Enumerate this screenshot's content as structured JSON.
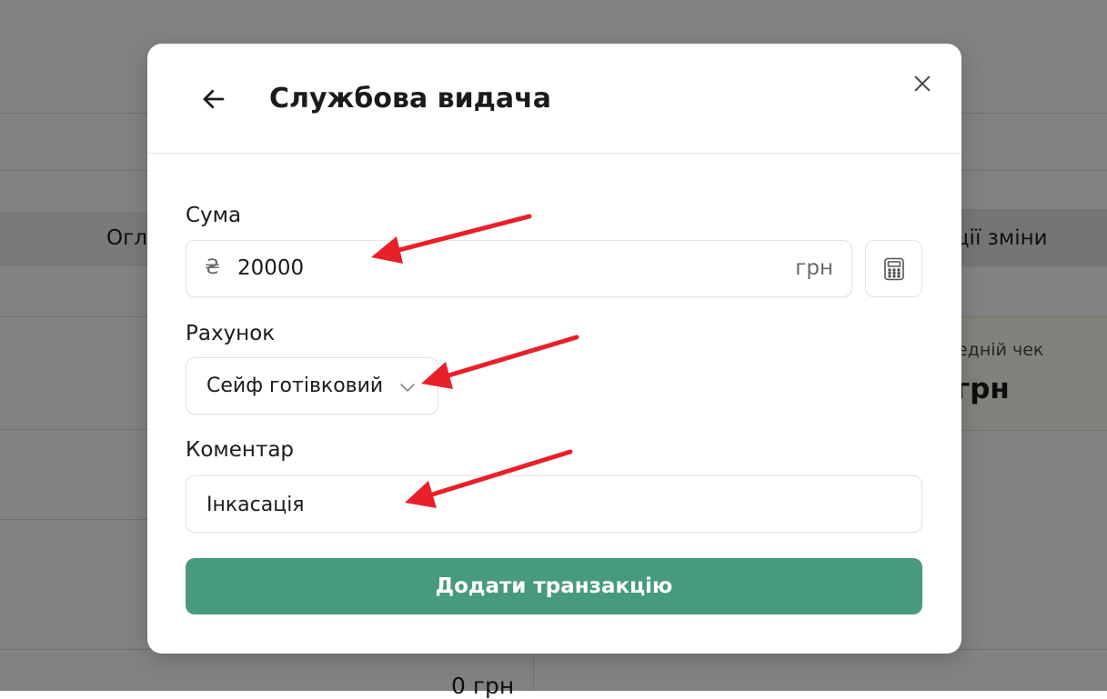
{
  "background": {
    "tab_left_partial": "Огл",
    "tab_right_partial": "кції зміни",
    "stat_label_partial": "редній чек",
    "stat_value_partial": "грн",
    "bottom_value_partial": "0 грн"
  },
  "modal": {
    "title": "Службова видача",
    "back_icon": "arrow-left-icon",
    "close_icon": "close-icon",
    "amount": {
      "label": "Сума",
      "currency_symbol": "₴",
      "value": "20000",
      "unit": "грн",
      "calculator_icon": "calculator-icon"
    },
    "account": {
      "label": "Рахунок",
      "selected": "Сейф готівковий",
      "chevron_icon": "chevron-down-icon"
    },
    "comment": {
      "label": "Коментар",
      "value": "Інкасація"
    },
    "submit_label": "Додати транзакцію"
  },
  "colors": {
    "primary_button": "#479a80",
    "overlay": "rgba(0,0,0,0.49)",
    "annotation_arrow": "#e8202a"
  }
}
